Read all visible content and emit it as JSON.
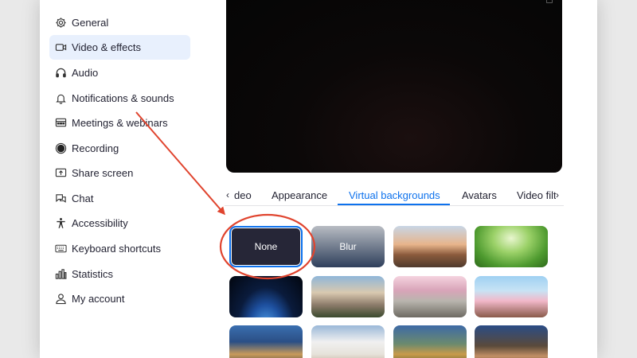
{
  "sidebar": {
    "items": [
      {
        "label": "General",
        "icon": "gear-icon"
      },
      {
        "label": "Video & effects",
        "icon": "video-camera-icon",
        "active": true
      },
      {
        "label": "Audio",
        "icon": "headphones-icon"
      },
      {
        "label": "Notifications & sounds",
        "icon": "bell-icon"
      },
      {
        "label": "Meetings & webinars",
        "icon": "calendar-icon"
      },
      {
        "label": "Recording",
        "icon": "record-icon"
      },
      {
        "label": "Share screen",
        "icon": "share-screen-icon"
      },
      {
        "label": "Chat",
        "icon": "chat-icon"
      },
      {
        "label": "Accessibility",
        "icon": "accessibility-icon"
      },
      {
        "label": "Keyboard shortcuts",
        "icon": "keyboard-icon"
      },
      {
        "label": "Statistics",
        "icon": "statistics-icon"
      },
      {
        "label": "My account",
        "icon": "user-icon"
      }
    ]
  },
  "tabs": {
    "left_arrow": "‹",
    "right_arrow": "›",
    "items": [
      "deo",
      "Appearance",
      "Virtual backgrounds",
      "Avatars",
      "Video filt"
    ],
    "active_index": 2
  },
  "backgrounds": {
    "none_label": "None",
    "blur_label": "Blur"
  },
  "colors": {
    "accent": "#0e72ed",
    "annotation": "#e0442e",
    "text": "#232333"
  }
}
